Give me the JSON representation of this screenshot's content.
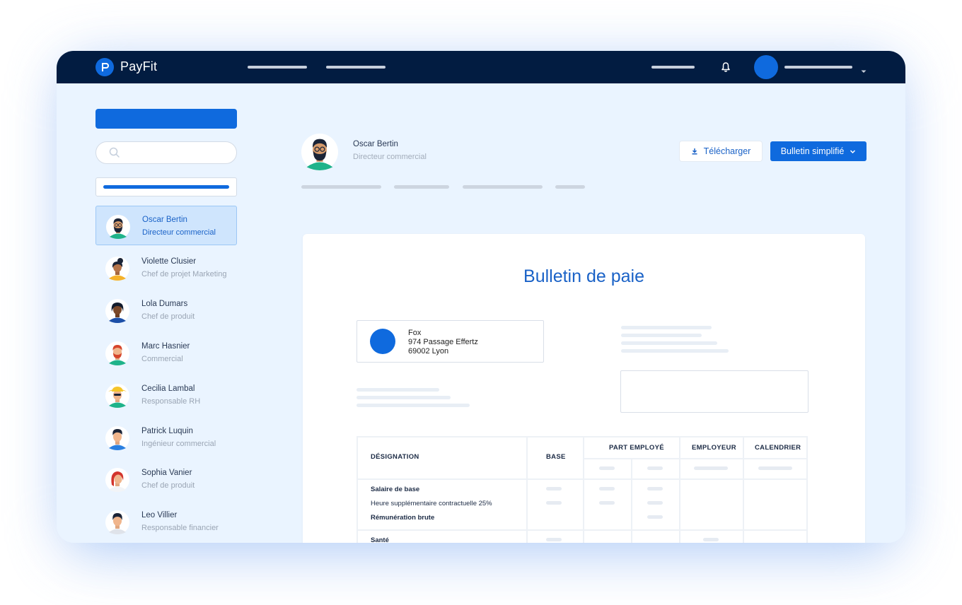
{
  "app": {
    "name": "PayFit"
  },
  "colors": {
    "navy": "#021c41",
    "primary": "#0f6ade",
    "background": "#eaf4ff"
  },
  "icons": {
    "logo": "payfit-logo-icon",
    "bell": "bell-icon",
    "caret": "caret-down-icon",
    "search": "search-icon",
    "download": "download-icon"
  },
  "employees": [
    {
      "name": "Oscar Bertin",
      "role": "Directeur commercial",
      "active": true
    },
    {
      "name": "Violette Clusier",
      "role": "Chef de projet Marketing"
    },
    {
      "name": "Lola Dumars",
      "role": "Chef de produit"
    },
    {
      "name": "Marc Hasnier",
      "role": "Commercial"
    },
    {
      "name": "Cecilia Lambal",
      "role": "Responsable RH"
    },
    {
      "name": "Patrick Luquin",
      "role": "Ingénieur commercial"
    },
    {
      "name": "Sophia Vanier",
      "role": "Chef de produit"
    },
    {
      "name": "Leo Villier",
      "role": "Responsable financier"
    }
  ],
  "selected": {
    "name": "Oscar Bertin",
    "role": "Directeur commercial"
  },
  "actions": {
    "download": "Télécharger",
    "bulletin": "Bulletin simplifié"
  },
  "payslip": {
    "title": "Bulletin de paie",
    "company": {
      "name": "Fox",
      "street": "974 Passage Effertz",
      "city": "69002 Lyon"
    },
    "table": {
      "headers": {
        "designation": "DÉSIGNATION",
        "base": "BASE",
        "part_employe": "PART EMPLOYÉ",
        "employeur": "EMPLOYEUR",
        "calendrier": "CALENDRIER"
      },
      "rows": [
        "Salaire de base",
        "Heure supplémentaire contractuelle 25%",
        "Rémunération brute",
        "Santé"
      ]
    }
  }
}
